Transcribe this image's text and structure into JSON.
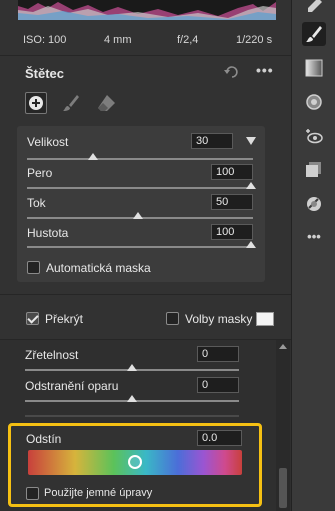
{
  "exif": {
    "iso": "ISO: 100",
    "focal": "4 mm",
    "aperture": "f/2,4",
    "shutter": "1/220 s"
  },
  "brush": {
    "title": "Štětec",
    "more_label": "•••"
  },
  "params": {
    "size": {
      "label": "Velikost",
      "value": "30",
      "level": 0.34
    },
    "feather": {
      "label": "Pero",
      "value": "100",
      "level": 1.0
    },
    "flow": {
      "label": "Tok",
      "value": "50",
      "level": 0.5
    },
    "density": {
      "label": "Hustota",
      "value": "100",
      "level": 1.0
    },
    "automask": {
      "label": "Automatická maska",
      "checked": false
    }
  },
  "overlay": {
    "label": "Překrýt",
    "checked": true,
    "mask_options_label": "Volby masky",
    "mask_options_checked": false,
    "swatch_color": "#f4f4f4"
  },
  "adjustments": {
    "clarity": {
      "label": "Zřetelnost",
      "value": "0",
      "level": 0.5
    },
    "dehaze": {
      "label": "Odstranění oparu",
      "value": "0",
      "level": 0.5
    }
  },
  "hue": {
    "label": "Odstín",
    "value": "0.0",
    "level": 0.5,
    "fine_label": "Použijte jemné úpravy",
    "fine_checked": false,
    "highlight_color": "#f5c013"
  },
  "toolstrip": {
    "tools": [
      "pen-icon",
      "brush-icon",
      "gradient-icon",
      "radial-filter-icon",
      "red-eye-icon",
      "snapshots-icon",
      "presets-icon",
      "more-icon"
    ],
    "more_label": "•••"
  }
}
